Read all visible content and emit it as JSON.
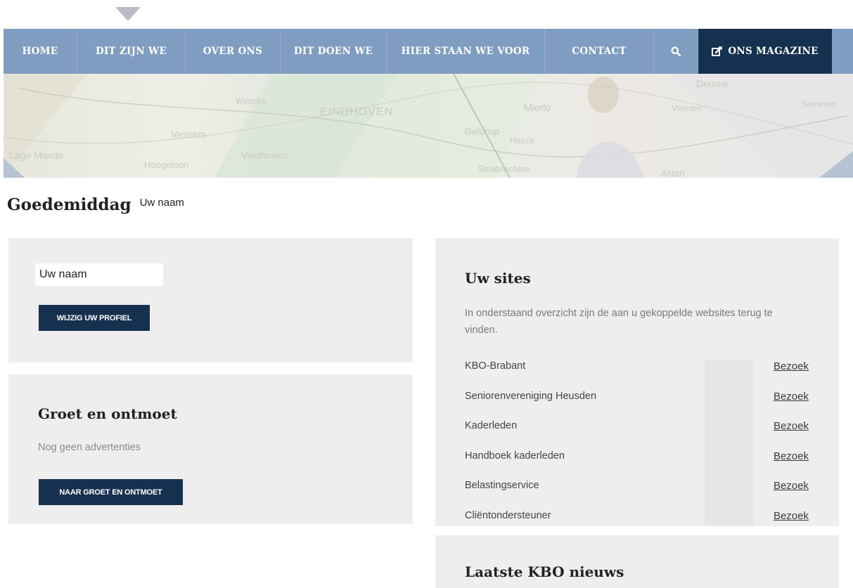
{
  "nav": {
    "items": [
      {
        "label": "HOME"
      },
      {
        "label": "DIT ZIJN WE"
      },
      {
        "label": "OVER ONS"
      },
      {
        "label": "DIT DOEN WE"
      },
      {
        "label": "HIER STAAN WE VOOR"
      },
      {
        "label": "CONTACT"
      }
    ],
    "search_icon": "search-icon",
    "magazine_label": "ONS MAGAZINE",
    "magazine_icon": "edit-icon"
  },
  "hero": {
    "map_labels": [
      "Lage Mierde",
      "Vessem",
      "Wintelre",
      "EINDHOVEN",
      "Veldhoven",
      "Hoogeloon",
      "Geldrop",
      "Mierlo",
      "Heeze",
      "Strabrechtse",
      "Deurne",
      "Vlierden",
      "Asten",
      "Someren"
    ]
  },
  "greeting": {
    "title": "Goedemiddag",
    "name": "Uw naam"
  },
  "profile": {
    "name_value": "Uw naam",
    "button_label": "WIJZIG UW PROFIEL"
  },
  "groet": {
    "title": "Groet en ontmoet",
    "empty_text": "Nog geen advertenties",
    "button_label": "NAAR GROET EN ONTMOET"
  },
  "sites": {
    "title": "Uw sites",
    "description": "In onderstaand overzicht zijn de aan u gekoppelde websites terug te vinden.",
    "link_label": "Bezoek",
    "items": [
      {
        "name": "KBO-Brabant"
      },
      {
        "name": "Seniorenvereniging Heusden"
      },
      {
        "name": "Kaderleden"
      },
      {
        "name": "Handboek kaderleden"
      },
      {
        "name": "Belastingservice"
      },
      {
        "name": "Cliëntondersteuner"
      }
    ]
  },
  "news": {
    "title": "Laatste KBO nieuws"
  },
  "colors": {
    "nav_bg": "#7f9dc0",
    "accent_dark": "#16314f",
    "card_bg": "#eeeeee"
  }
}
